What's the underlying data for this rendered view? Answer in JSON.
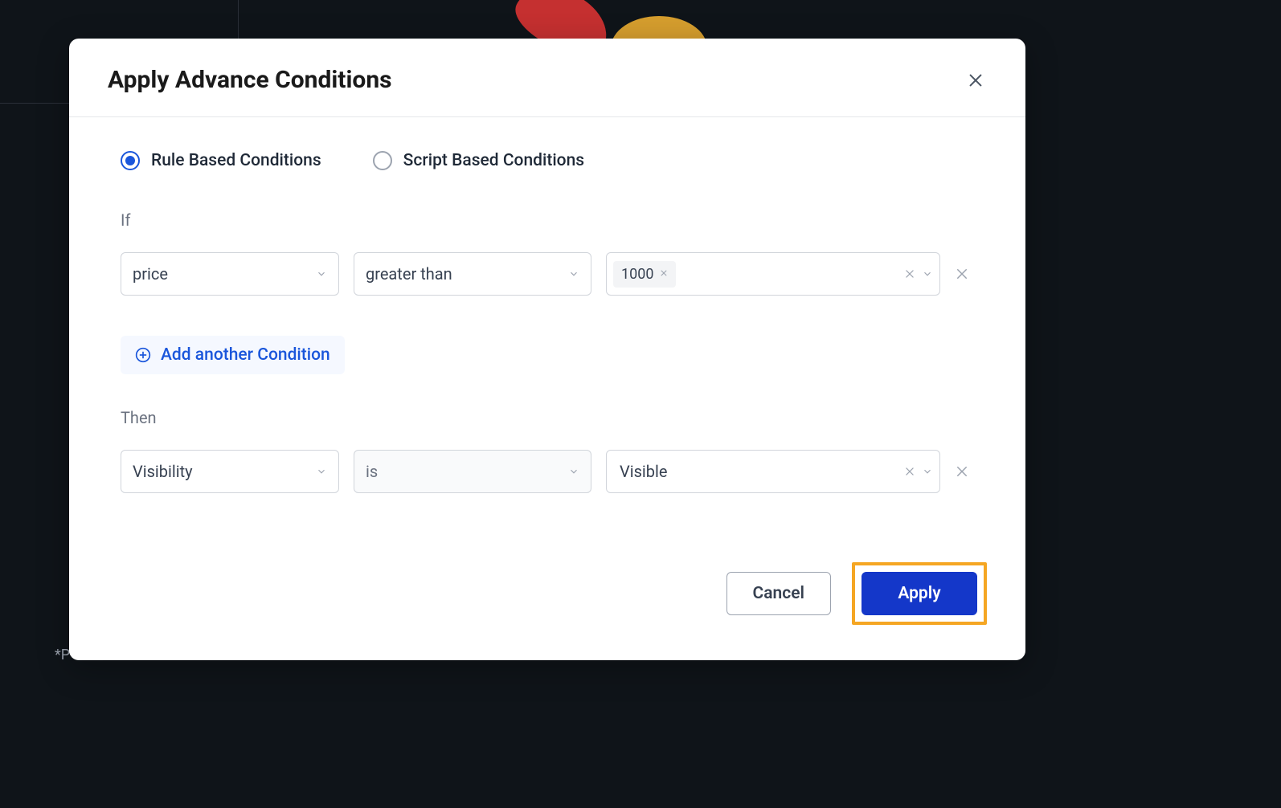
{
  "modal": {
    "title": "Apply Advance Conditions",
    "radios": {
      "rule": "Rule Based Conditions",
      "script": "Script Based Conditions",
      "selected": "rule"
    },
    "if_label": "If",
    "then_label": "Then",
    "if_condition": {
      "field": "price",
      "operator": "greater than",
      "value_tag": "1000"
    },
    "add_condition_label": "Add another Condition",
    "then_condition": {
      "field": "Visibility",
      "operator": "is",
      "value": "Visible"
    },
    "buttons": {
      "cancel": "Cancel",
      "apply": "Apply"
    }
  },
  "backdrop_text": "*P"
}
